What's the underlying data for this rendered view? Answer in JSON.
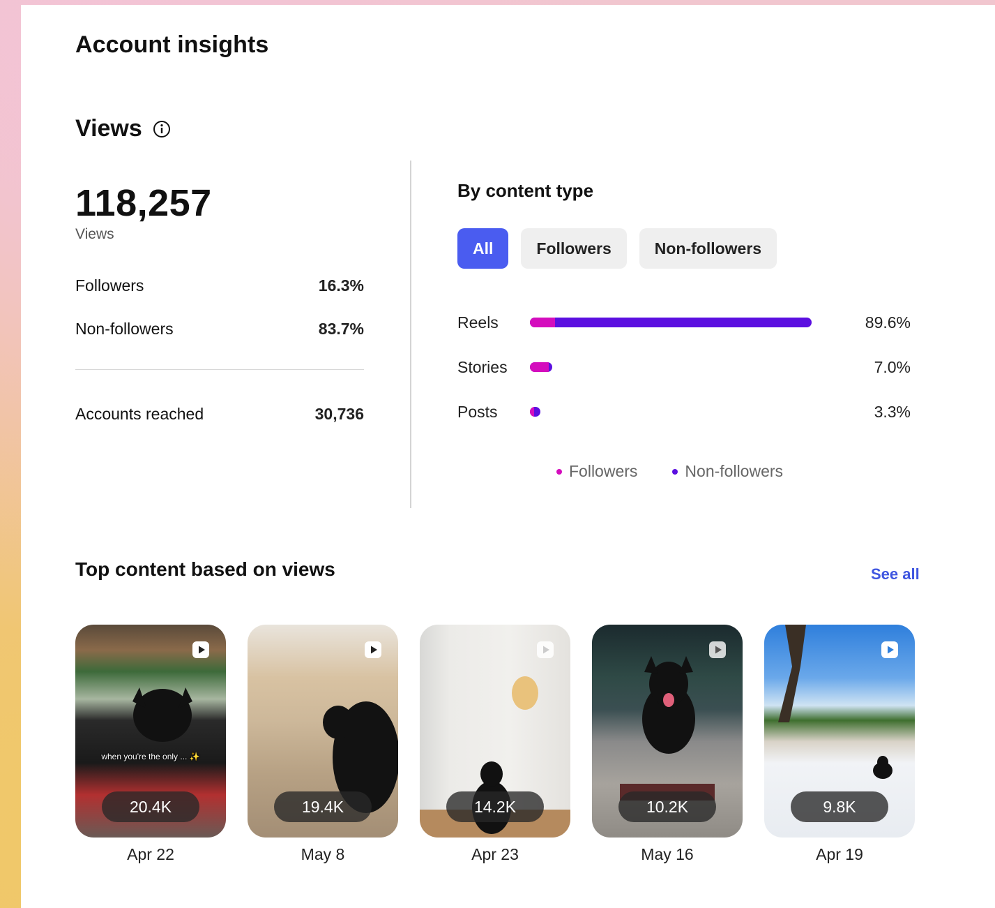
{
  "header": {
    "title": "Account insights"
  },
  "views": {
    "heading": "Views",
    "total": "118,257",
    "total_label": "Views",
    "followers_label": "Followers",
    "followers_pct": "16.3%",
    "nonfollowers_label": "Non-followers",
    "nonfollowers_pct": "83.7%",
    "reached_label": "Accounts reached",
    "reached_value": "30,736"
  },
  "content_type": {
    "heading": "By content type",
    "tabs": [
      "All",
      "Followers",
      "Non-followers"
    ],
    "active_tab": "All",
    "bars": [
      {
        "label": "Reels",
        "pct_text": "89.6%",
        "value": 89.6,
        "followers_share": 0.09
      },
      {
        "label": "Stories",
        "pct_text": "7.0%",
        "value": 7.0,
        "followers_share": 0.85
      },
      {
        "label": "Posts",
        "pct_text": "3.3%",
        "value": 3.3,
        "followers_share": 0.4
      }
    ],
    "legend": [
      {
        "label": "Followers",
        "color": "#d40dbd"
      },
      {
        "label": "Non-followers",
        "color": "#5b0fe0"
      }
    ]
  },
  "top_content": {
    "heading": "Top content based on views",
    "see_all": "See all",
    "items": [
      {
        "count": "20.4K",
        "date": "Apr 22",
        "caption": "when you're the only ... ✨",
        "icon": "reel-icon"
      },
      {
        "count": "19.4K",
        "date": "May 8",
        "caption": "",
        "icon": "reel-icon"
      },
      {
        "count": "14.2K",
        "date": "Apr 23",
        "caption": "",
        "icon": "reel-icon"
      },
      {
        "count": "10.2K",
        "date": "May 16",
        "caption": "",
        "icon": "reel-icon"
      },
      {
        "count": "9.8K",
        "date": "Apr 19",
        "caption": "",
        "icon": "reel-icon"
      }
    ]
  },
  "colors": {
    "accent": "#4a5cf0",
    "followers": "#d40dbd",
    "nonfollowers": "#5b0fe0",
    "link": "#3f56e0"
  }
}
